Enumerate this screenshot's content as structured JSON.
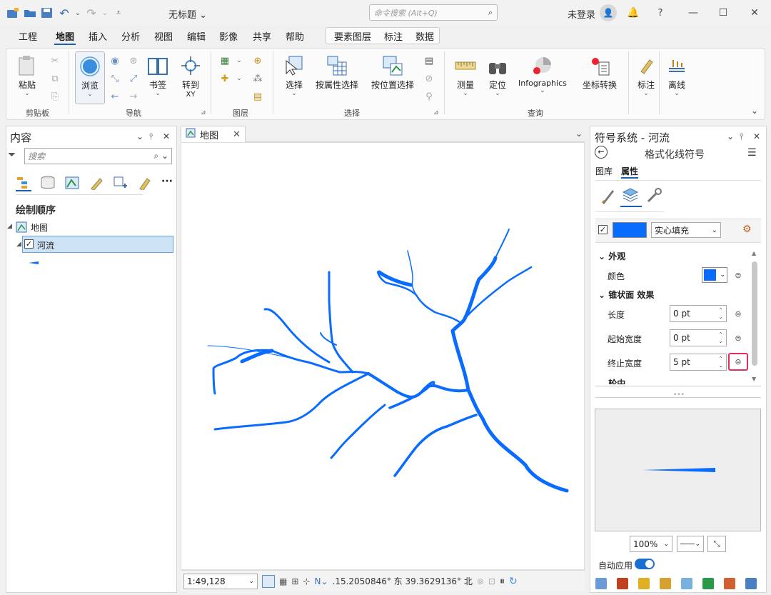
{
  "quick_access": [
    "new-project-icon",
    "open-project-icon",
    "save-project-icon",
    "undo-icon",
    "redo-icon",
    "customize-icon"
  ],
  "doc_title": "无标题 ⌄",
  "command_search": {
    "placeholder": "命令搜索 (Alt+Q)"
  },
  "login_label": "未登录",
  "window_controls": {
    "help": "?"
  },
  "menu": [
    "工程",
    "地图",
    "插入",
    "分析",
    "视图",
    "编辑",
    "影像",
    "共享",
    "帮助"
  ],
  "context_menu": [
    "要素图层",
    "标注",
    "数据"
  ],
  "ribbon": {
    "paste": "粘贴",
    "clipboard_group": "剪贴板",
    "browse": "浏览",
    "bookmark": "书签",
    "goto": "转到",
    "goto_sub": "XY",
    "nav_group": "导航",
    "layer_group": "图层",
    "select": "选择",
    "select_by_attr": "按属性选择",
    "select_by_loc": "按位置选择",
    "select_group": "选择",
    "measure": "测量",
    "locate": "定位",
    "infographics": "Infographics",
    "coord_convert": "坐标转换",
    "query_group": "查询",
    "label": "标注",
    "offline": "离线"
  },
  "contents": {
    "title": "内容",
    "search_placeholder": "搜索",
    "drawing_order": "绘制顺序",
    "map_item": "地图",
    "layer_item": "河流",
    "more": "···"
  },
  "map_tab": {
    "label": "地图"
  },
  "status": {
    "scale": "1:49,128",
    "coords": ".15.2050846° 东  39.3629136° 北"
  },
  "symbology": {
    "title": "符号系统 - 河流",
    "subtitle": "格式化线符号",
    "tab_gallery": "图库",
    "tab_properties": "属性",
    "fill_type": "实心填充",
    "section_appearance": "外观",
    "color_label": "颜色",
    "section_effects": "锥状面 效果",
    "length_label": "长度",
    "length_value": "0 pt",
    "start_width_label": "起始宽度",
    "start_width_value": "0 pt",
    "end_width_label": "终止宽度",
    "end_width_value": "5 pt",
    "next_section": "轮中",
    "zoom": "100%",
    "auto_apply": "自动应用",
    "color": "#0a6cff",
    "highlight": "#e0305a"
  },
  "colors": {
    "accent": "#1a5fb4",
    "river": "#0a6cff"
  }
}
